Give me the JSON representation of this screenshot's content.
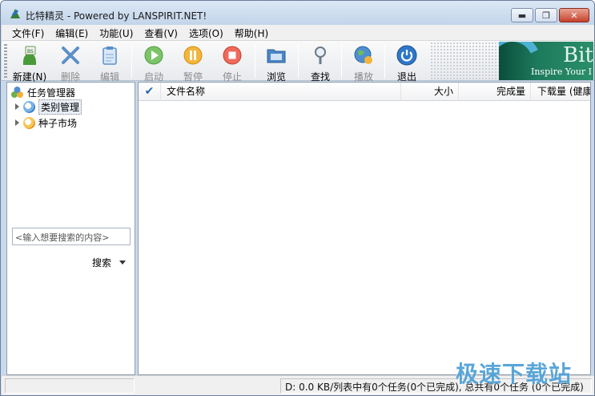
{
  "window": {
    "title": "比特精灵 - Powered by LANSPIRIT.NET!",
    "controls": {
      "minimize": "▬",
      "maximize": "❐",
      "close": "✕"
    }
  },
  "menu": [
    {
      "label": "文件(F)"
    },
    {
      "label": "编辑(E)"
    },
    {
      "label": "功能(U)"
    },
    {
      "label": "查看(V)"
    },
    {
      "label": "选项(O)"
    },
    {
      "label": "帮助(H)"
    }
  ],
  "toolbar": {
    "new": {
      "label": "新建(N)",
      "icon": "new-task-icon",
      "enabled": true
    },
    "delete": {
      "label": "删除",
      "icon": "delete-x-icon",
      "enabled": false
    },
    "edit": {
      "label": "编辑",
      "icon": "clipboard-edit-icon",
      "enabled": false
    },
    "start": {
      "label": "启动",
      "icon": "play-icon",
      "enabled": false
    },
    "pause": {
      "label": "暂停",
      "icon": "pause-icon",
      "enabled": false
    },
    "stop": {
      "label": "停止",
      "icon": "stop-icon",
      "enabled": false
    },
    "browse": {
      "label": "浏览",
      "icon": "folder-browse-icon",
      "enabled": true
    },
    "find": {
      "label": "查找",
      "icon": "magnifier-icon",
      "enabled": true
    },
    "play": {
      "label": "播放",
      "icon": "globe-play-icon",
      "enabled": false
    },
    "exit": {
      "label": "退出",
      "icon": "power-icon",
      "enabled": true
    },
    "banner": {
      "big": "Bit",
      "tagline": "Inspire Your I"
    }
  },
  "tree": {
    "root": "任务管理器",
    "nodes": [
      {
        "label": "类别管理",
        "selected": true
      },
      {
        "label": "种子市场",
        "selected": false
      }
    ]
  },
  "search": {
    "placeholder": "<输入想要搜索的内容>",
    "button": "搜索"
  },
  "list": {
    "columns": [
      {
        "label": "✔"
      },
      {
        "label": "文件名称"
      },
      {
        "label": "大小"
      },
      {
        "label": "完成量"
      },
      {
        "label": "下载量 (健康"
      }
    ],
    "rows": []
  },
  "status": {
    "text": "D: 0.0 KB/列表中有0个任务(0个已完成), 总共有0个任务 (0个已完成)"
  },
  "watermark": "极速下载站",
  "colors": {
    "window_frame": "#c9d9ec",
    "accent_blue": "#2868b0",
    "banner_green": "#1d7a5c",
    "watermark": "#4d9fd6"
  }
}
